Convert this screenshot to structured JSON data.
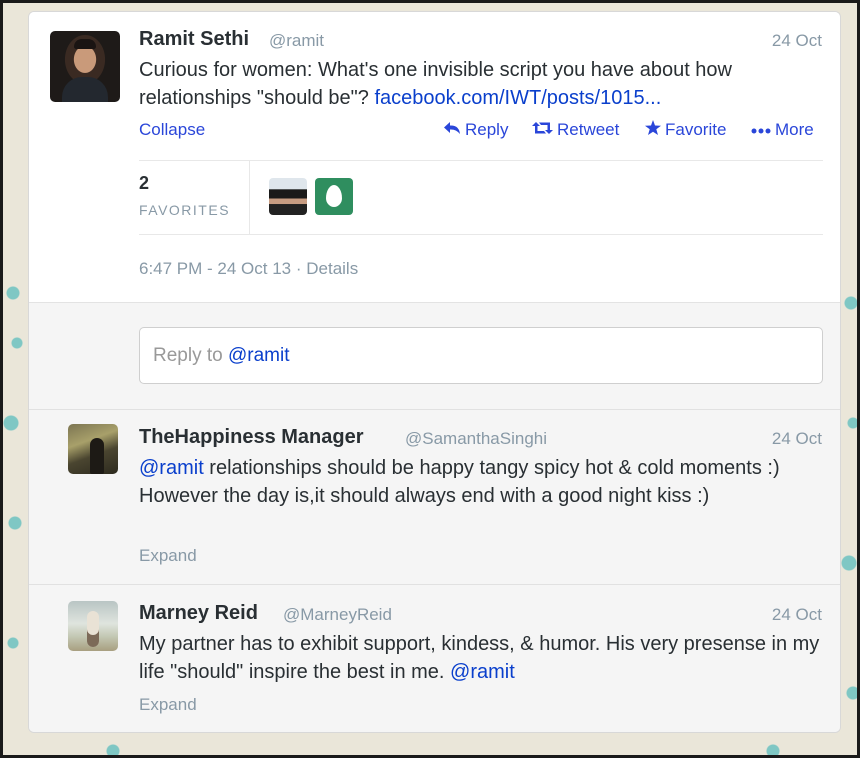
{
  "main_tweet": {
    "name": "Ramit Sethi",
    "handle": "@ramit",
    "date": "24 Oct",
    "text": "Curious for women: What's one invisible script you have about how relationships \"should be\"?",
    "link": "facebook.com/IWT/posts/1015...",
    "collapse_label": "Collapse",
    "actions": {
      "reply": "Reply",
      "retweet": "Retweet",
      "favorite": "Favorite",
      "more": "More"
    },
    "favorites_count": "2",
    "favorites_label": "FAVORITES",
    "timestamp": "6:47 PM - 24 Oct 13",
    "details_label": "Details"
  },
  "reply_box": {
    "placeholder_prefix": "Reply to",
    "mention": "@ramit"
  },
  "replies": [
    {
      "name": "TheHappiness Manager",
      "handle": "@SamanthaSinghi",
      "date": "24 Oct",
      "mention": "@ramit",
      "text": " relationships should be happy tangy spicy hot & cold moments :) However the day is,it should always end with a good night kiss :)",
      "expand_label": "Expand"
    },
    {
      "name": "Marney Reid",
      "handle": "@MarneyReid",
      "date": "24 Oct",
      "text": "My partner has to exhibit support, kindess, & humor. His very presense in my life \"should\" inspire the best in me. ",
      "mention": "@ramit",
      "expand_label": "Expand"
    }
  ],
  "colors": {
    "link": "#0a3fcc",
    "action": "#2a46d9",
    "muted": "#8899a6",
    "text": "#292f33"
  }
}
